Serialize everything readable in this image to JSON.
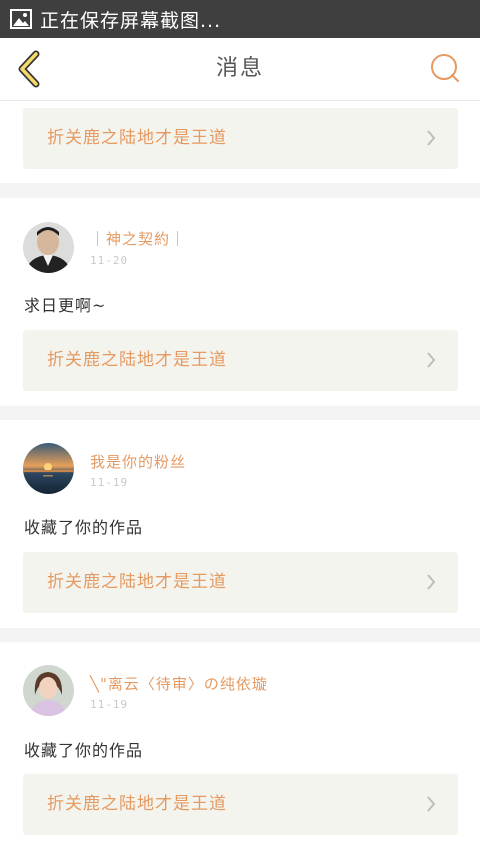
{
  "status_bar": {
    "text": "正在保存屏幕截图..."
  },
  "header": {
    "title": "消息"
  },
  "first_card": {
    "book_title": "折关鹿之陆地才是王道"
  },
  "messages": [
    {
      "username": "｜神之契約｜",
      "date": "11-20",
      "message": "求日更啊~",
      "book_title": "折关鹿之陆地才是王道"
    },
    {
      "username": "我是你的粉丝",
      "date": "11-19",
      "message": "收藏了你的作品",
      "book_title": "折关鹿之陆地才是王道"
    },
    {
      "username": "╲\"离云〈待审〉の纯依璇",
      "date": "11-19",
      "message": "收藏了你的作品",
      "book_title": "折关鹿之陆地才是王道"
    }
  ],
  "colors": {
    "accent": "#e59a62",
    "status_bar": "#3f3f3f",
    "back_icon_fill": "#f4d96b"
  }
}
